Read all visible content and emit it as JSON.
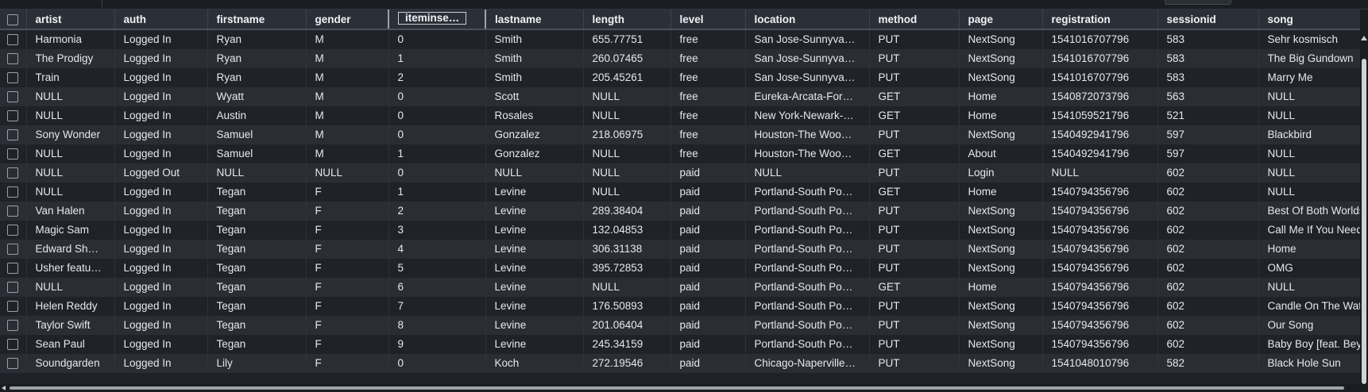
{
  "grid": {
    "columns": [
      "artist",
      "auth",
      "firstname",
      "gender",
      "iteminse…",
      "lastname",
      "length",
      "level",
      "location",
      "method",
      "page",
      "registration",
      "sessionid",
      "song"
    ],
    "rows": [
      [
        "Harmonia",
        "Logged In",
        "Ryan",
        "M",
        "0",
        "Smith",
        "655.77751",
        "free",
        "San Jose-Sunnyva…",
        "PUT",
        "NextSong",
        "1541016707796",
        "583",
        "Sehr kosmisch"
      ],
      [
        "The Prodigy",
        "Logged In",
        "Ryan",
        "M",
        "1",
        "Smith",
        "260.07465",
        "free",
        "San Jose-Sunnyva…",
        "PUT",
        "NextSong",
        "1541016707796",
        "583",
        "The Big Gundown"
      ],
      [
        "Train",
        "Logged In",
        "Ryan",
        "M",
        "2",
        "Smith",
        "205.45261",
        "free",
        "San Jose-Sunnyva…",
        "PUT",
        "NextSong",
        "1541016707796",
        "583",
        "Marry Me"
      ],
      [
        "NULL",
        "Logged In",
        "Wyatt",
        "M",
        "0",
        "Scott",
        "NULL",
        "free",
        "Eureka-Arcata-For…",
        "GET",
        "Home",
        "1540872073796",
        "563",
        "NULL"
      ],
      [
        "NULL",
        "Logged In",
        "Austin",
        "M",
        "0",
        "Rosales",
        "NULL",
        "free",
        "New York-Newark-…",
        "GET",
        "Home",
        "1541059521796",
        "521",
        "NULL"
      ],
      [
        "Sony Wonder",
        "Logged In",
        "Samuel",
        "M",
        "0",
        "Gonzalez",
        "218.06975",
        "free",
        "Houston-The Woo…",
        "PUT",
        "NextSong",
        "1540492941796",
        "597",
        "Blackbird"
      ],
      [
        "NULL",
        "Logged In",
        "Samuel",
        "M",
        "1",
        "Gonzalez",
        "NULL",
        "free",
        "Houston-The Woo…",
        "GET",
        "About",
        "1540492941796",
        "597",
        "NULL"
      ],
      [
        "NULL",
        "Logged Out",
        "NULL",
        "NULL",
        "0",
        "NULL",
        "NULL",
        "paid",
        "NULL",
        "PUT",
        "Login",
        "NULL",
        "602",
        "NULL"
      ],
      [
        "NULL",
        "Logged In",
        "Tegan",
        "F",
        "1",
        "Levine",
        "NULL",
        "paid",
        "Portland-South Po…",
        "GET",
        "Home",
        "1540794356796",
        "602",
        "NULL"
      ],
      [
        "Van Halen",
        "Logged In",
        "Tegan",
        "F",
        "2",
        "Levine",
        "289.38404",
        "paid",
        "Portland-South Po…",
        "PUT",
        "NextSong",
        "1540794356796",
        "602",
        "Best Of Both Worlds"
      ],
      [
        "Magic Sam",
        "Logged In",
        "Tegan",
        "F",
        "3",
        "Levine",
        "132.04853",
        "paid",
        "Portland-South Po…",
        "PUT",
        "NextSong",
        "1540794356796",
        "602",
        "Call Me If You Need Me"
      ],
      [
        "Edward Sh…",
        "Logged In",
        "Tegan",
        "F",
        "4",
        "Levine",
        "306.31138",
        "paid",
        "Portland-South Po…",
        "PUT",
        "NextSong",
        "1540794356796",
        "602",
        "Home"
      ],
      [
        "Usher featu…",
        "Logged In",
        "Tegan",
        "F",
        "5",
        "Levine",
        "395.72853",
        "paid",
        "Portland-South Po…",
        "PUT",
        "NextSong",
        "1540794356796",
        "602",
        "OMG"
      ],
      [
        "NULL",
        "Logged In",
        "Tegan",
        "F",
        "6",
        "Levine",
        "NULL",
        "paid",
        "Portland-South Po…",
        "GET",
        "Home",
        "1540794356796",
        "602",
        "NULL"
      ],
      [
        "Helen Reddy",
        "Logged In",
        "Tegan",
        "F",
        "7",
        "Levine",
        "176.50893",
        "paid",
        "Portland-South Po…",
        "PUT",
        "NextSong",
        "1540794356796",
        "602",
        "Candle On The Water"
      ],
      [
        "Taylor Swift",
        "Logged In",
        "Tegan",
        "F",
        "8",
        "Levine",
        "201.06404",
        "paid",
        "Portland-South Po…",
        "PUT",
        "NextSong",
        "1540794356796",
        "602",
        "Our Song"
      ],
      [
        "Sean Paul",
        "Logged In",
        "Tegan",
        "F",
        "9",
        "Levine",
        "245.34159",
        "paid",
        "Portland-South Po…",
        "PUT",
        "NextSong",
        "1540794356796",
        "602",
        "Baby Boy [feat. Beyonce]"
      ],
      [
        "Soundgarden",
        "Logged In",
        "Lily",
        "F",
        "0",
        "Koch",
        "272.19546",
        "paid",
        "Chicago-Naperville…",
        "PUT",
        "NextSong",
        "1541048010796",
        "582",
        "Black Hole Sun"
      ]
    ]
  }
}
